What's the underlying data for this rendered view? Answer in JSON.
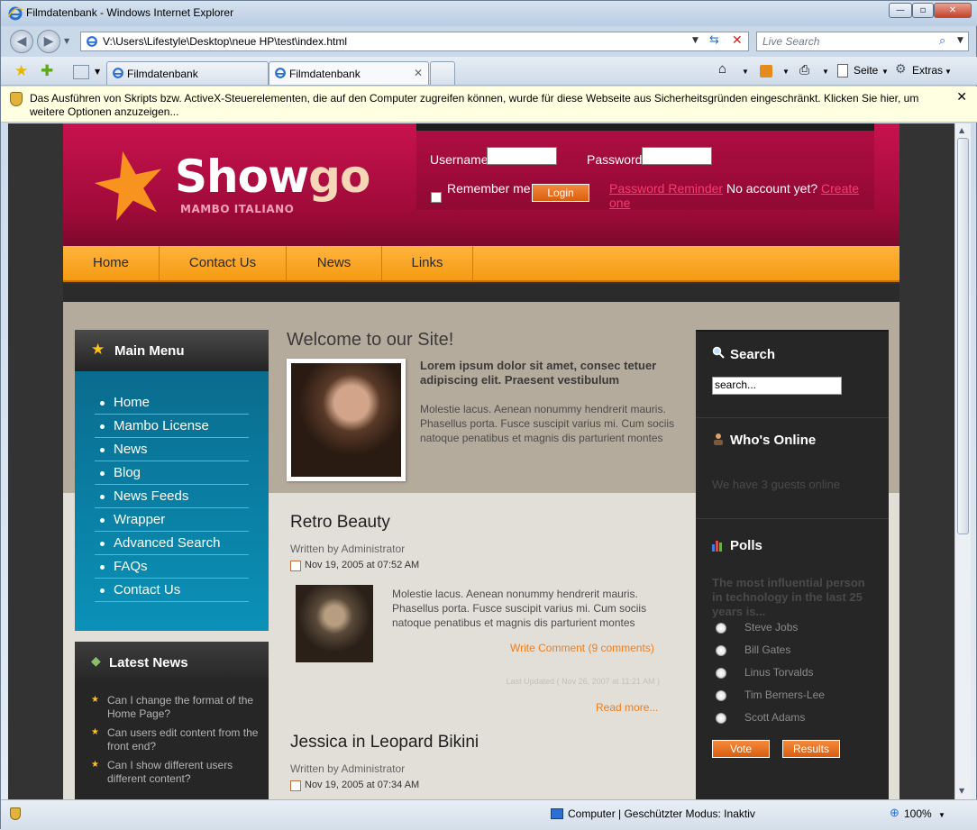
{
  "browser": {
    "window_title": "Filmdatenbank - Windows Internet Explorer",
    "address": "V:\\Users\\Lifestyle\\Desktop\\neue HP\\test\\index.html",
    "live_search_placeholder": "Live Search",
    "tabs": [
      {
        "label": "Filmdatenbank"
      },
      {
        "label": "Filmdatenbank"
      }
    ],
    "toolbar": {
      "page_label": "Seite",
      "extras_label": "Extras"
    },
    "infobar": "Das Ausführen von Skripts bzw. ActiveX-Steuerelementen, die auf den Computer zugreifen können, wurde für diese Webseite aus Sicherheitsgründen eingeschränkt. Klicken Sie hier, um weitere Optionen anzuzeigen...",
    "status": {
      "zone": "Computer | Geschützter Modus: Inaktiv",
      "zoom": "100%"
    }
  },
  "site": {
    "logo": {
      "show": "Show",
      "go": "go",
      "subtitle": "MAMBO ITALIANO"
    },
    "login": {
      "username_label": "Username",
      "password_label": "Password",
      "remember_label": "Remember me",
      "login_button": "Login",
      "reminder_link": "Password Reminder",
      "no_account": "No account yet?",
      "create_link": "Create one"
    },
    "nav": [
      "Home",
      "Contact Us",
      "News",
      "Links"
    ],
    "main_menu": {
      "title": "Main Menu",
      "items": [
        "Home",
        "Mambo License",
        "News",
        "Blog",
        "News Feeds",
        "Wrapper",
        "Advanced Search",
        "FAQs",
        "Contact Us"
      ]
    },
    "latest_news": {
      "title": "Latest News",
      "items": [
        "Can I change the format of the Home Page?",
        "Can users edit content from the front end?",
        "Can I show different users different content?"
      ]
    },
    "welcome": {
      "heading": "Welcome to our Site!",
      "bold": "Lorem ipsum dolor sit amet, consec tetuer adipiscing elit. Praesent vestibulum",
      "text": "Molestie lacus. Aenean nonummy hendrerit mauris. Phasellus porta. Fusce suscipit varius mi. Cum sociis natoque penatibus et magnis dis parturient montes"
    },
    "articles": [
      {
        "title": "Retro Beauty",
        "author": "Written by Administrator",
        "date": "Nov 19, 2005 at 07:52 AM",
        "text": "Molestie lacus. Aenean nonummy hendrerit mauris. Phasellus porta. Fusce suscipit varius mi. Cum sociis natoque penatibus et magnis dis parturient montes",
        "comment_link": "Write Comment (9 comments)",
        "updated": "Last Updated ( Nov 26, 2007 at 11:21 AM )",
        "read_more": "Read more..."
      },
      {
        "title": "Jessica in Leopard Bikini",
        "author": "Written by Administrator",
        "date": "Nov 19, 2005 at 07:34 AM"
      }
    ],
    "search": {
      "title": "Search",
      "value": "search..."
    },
    "whos_online": {
      "title": "Who's Online",
      "text": "We have 3 guests online"
    },
    "polls": {
      "title": "Polls",
      "question": "The most influential person in technology in the last 25 years is...",
      "options": [
        "Steve Jobs",
        "Bill Gates",
        "Linus Torvalds",
        "Tim Berners-Lee",
        "Scott Adams"
      ],
      "vote_button": "Vote",
      "results_button": "Results"
    }
  }
}
